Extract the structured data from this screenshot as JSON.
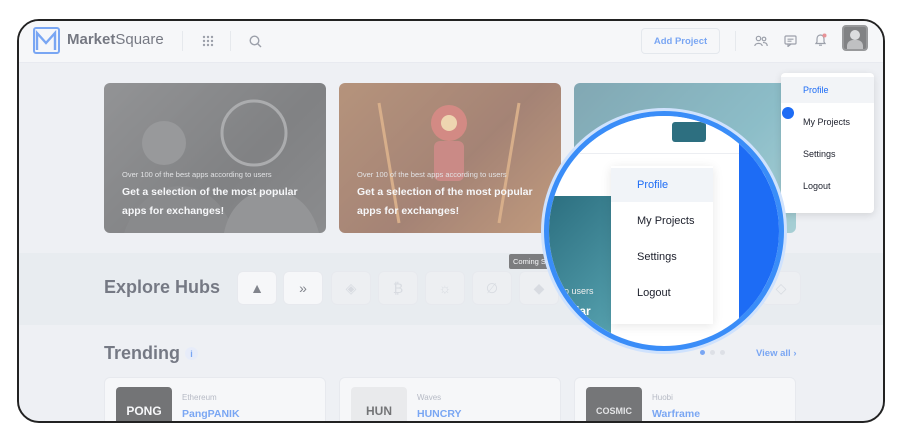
{
  "header": {
    "brand_bold": "Market",
    "brand_light": "Square",
    "add_project_label": "Add Project",
    "icons": [
      "grid-icon",
      "search-icon",
      "users-icon",
      "chat-icon",
      "bell-icon"
    ]
  },
  "banners": [
    {
      "subtitle": "Over 100 of the best apps according to users",
      "title": "Get a selection of the most popular apps for exchanges!"
    },
    {
      "subtitle": "Over 100 of the best apps according to users",
      "title": "Get a selection of the most popular apps for exchanges!"
    }
  ],
  "hubs": {
    "title": "Explore Hubs",
    "tooltip": "Coming Soon"
  },
  "trending": {
    "title": "Trending",
    "view_all": "View all ›",
    "items": [
      {
        "network": "Ethereum",
        "name": "PangPANIK",
        "thumb_label": "PONG"
      },
      {
        "network": "Waves",
        "name": "HUNCRY",
        "thumb_label": "HUN"
      },
      {
        "network": "Huobi",
        "name": "Warframe",
        "thumb_label": "COSMIC"
      }
    ]
  },
  "profile_menu": {
    "items": [
      "Profile",
      "My Projects",
      "Settings",
      "Logout"
    ],
    "active": "Profile"
  },
  "magnifier": {
    "items": [
      "Profile",
      "My Projects",
      "Settings",
      "Logout"
    ],
    "banner_fragment_sub": "g to users",
    "banner_fragment_title": "opular"
  },
  "colors": {
    "accent": "#1d6cf5",
    "ring": "#3a8df8"
  }
}
